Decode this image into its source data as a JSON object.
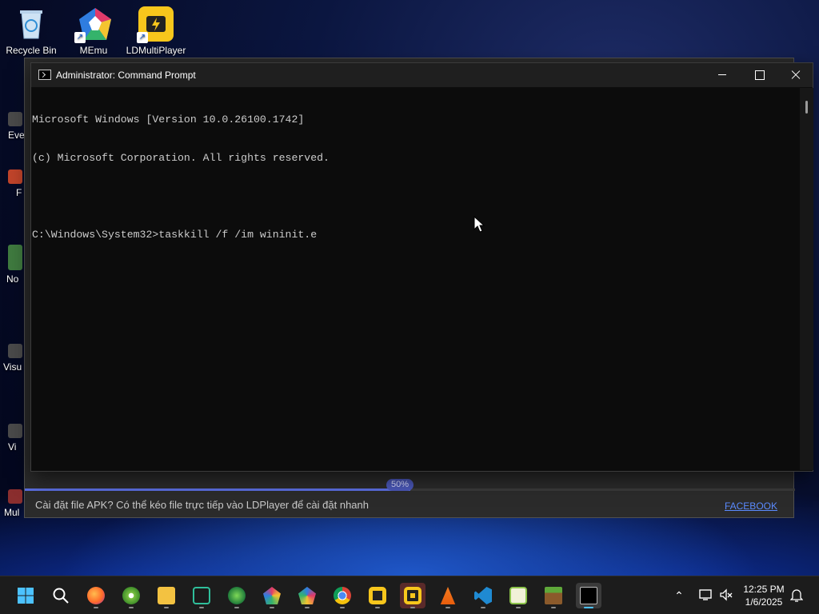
{
  "desktop": {
    "icons": [
      {
        "label": "Recycle Bin",
        "icon": "recycle-bin-icon"
      },
      {
        "label": "MEmu",
        "icon": "memu-icon"
      },
      {
        "label": "LDMultiPlayer",
        "icon": "ldmultiplayer-icon"
      }
    ],
    "side_stubs": [
      "Eve",
      "F",
      "No",
      "Visu",
      "Vi",
      "Mul"
    ]
  },
  "ld_window": {
    "progress_percent": 50,
    "progress_label": "50%",
    "tip": "Cài đặt file APK? Có thể kéo file trực tiếp vào LDPlayer để cài đặt nhanh",
    "link": "FACEBOOK"
  },
  "cmd": {
    "title": "Administrator: Command Prompt",
    "lines": [
      "Microsoft Windows [Version 10.0.26100.1742]",
      "(c) Microsoft Corporation. All rights reserved.",
      "",
      "C:\\Windows\\System32>taskkill /f /im wininit.e"
    ]
  },
  "taskbar": {
    "apps": [
      {
        "name": "start",
        "icon": "windows-start-icon"
      },
      {
        "name": "search",
        "icon": "search-icon"
      },
      {
        "name": "firefox",
        "icon": "firefox-icon"
      },
      {
        "name": "app-green-disc",
        "icon": "green-disc-icon"
      },
      {
        "name": "file-explorer",
        "icon": "folder-icon"
      },
      {
        "name": "app-vs",
        "icon": "vs-green-icon"
      },
      {
        "name": "app-globe",
        "icon": "globe-icon"
      },
      {
        "name": "memu-dark",
        "icon": "memu-dark-icon"
      },
      {
        "name": "memu",
        "icon": "memu-icon"
      },
      {
        "name": "chrome",
        "icon": "chrome-icon"
      },
      {
        "name": "ldmultiplayer",
        "icon": "ldmultiplayer-icon"
      },
      {
        "name": "ldplayer",
        "icon": "ldplayer-icon"
      },
      {
        "name": "vlc",
        "icon": "vlc-icon"
      },
      {
        "name": "vscode",
        "icon": "vscode-icon"
      },
      {
        "name": "notepad-plus-plus",
        "icon": "notepad-plus-plus-icon"
      },
      {
        "name": "minecraft",
        "icon": "minecraft-icon"
      },
      {
        "name": "command-prompt",
        "icon": "command-prompt-icon"
      }
    ],
    "clock_time": "12:25 PM",
    "clock_date": "1/6/2025"
  }
}
